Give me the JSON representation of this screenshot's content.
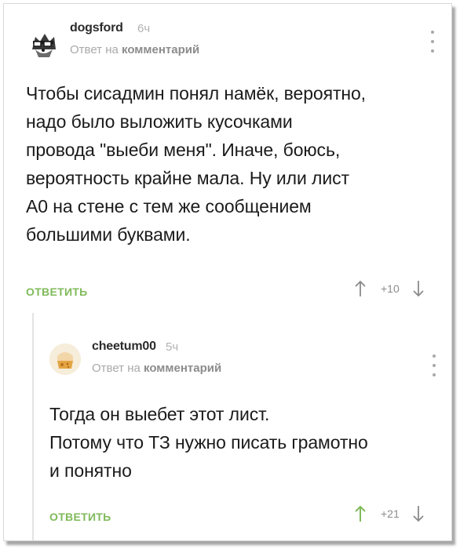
{
  "comments": [
    {
      "username": "dogsford",
      "time": "6ч",
      "reply_to_prefix": "Ответ на",
      "reply_to_link": "комментарий",
      "lines": [
        "Чтобы сисадмин понял намёк, вероятно,",
        "надо было выложить кусочками",
        "провода \"выеби меня\". Иначе, боюсь,",
        "вероятность крайне мала. Ну или лист",
        "А0 на стене с тем же сообщением",
        "большими буквами."
      ],
      "reply_label": "ОТВЕТИТЬ",
      "rating": "+10",
      "avatar_icon": "dog-glasses-avatar-icon"
    },
    {
      "username": "cheetum00",
      "time": "5ч",
      "reply_to_prefix": "Ответ на",
      "reply_to_link": "комментарий",
      "lines": [
        "Тогда он выебет этот лист.",
        "Потому что ТЗ нужно писать грамотно",
        "и понятно"
      ],
      "reply_label": "ОТВЕТИТЬ",
      "rating": "+21",
      "avatar_icon": "cheese-cat-avatar-icon"
    }
  ],
  "colors": {
    "accent_green": "#7fba5a",
    "text": "#1b1b1b",
    "muted": "#a9a9a9"
  }
}
